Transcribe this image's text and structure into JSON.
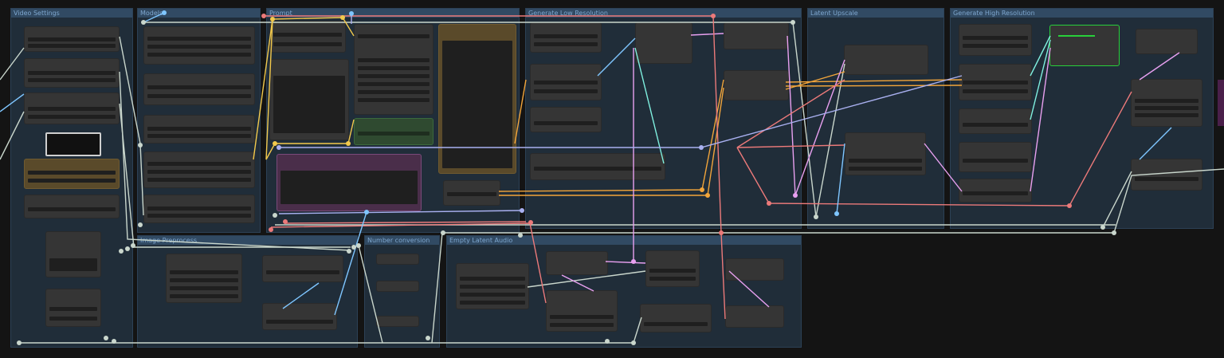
{
  "app": {
    "name": "node-graph-editor"
  },
  "groups": [
    {
      "id": "video_settings",
      "title": "Video Settings"
    },
    {
      "id": "models",
      "title": "Models"
    },
    {
      "id": "prompt",
      "title": "Prompt"
    },
    {
      "id": "low_res",
      "title": "Generate Low Resolution"
    },
    {
      "id": "latent_upscale",
      "title": "Latent Upscale"
    },
    {
      "id": "high_res",
      "title": "Generate High Resolution"
    },
    {
      "id": "image_preprocess",
      "title": "Image Preprocess"
    },
    {
      "id": "number_conversion",
      "title": "Number conversion"
    },
    {
      "id": "empty_latent_audio",
      "title": "Empty Latent Audio"
    }
  ],
  "colors": {
    "background": "#141414",
    "group_fill": "#31506e",
    "node_fill": "#353535",
    "selected_outline": "#28d03a",
    "wire_yellow": "#f2c94c",
    "wire_orange": "#f2a53b",
    "wire_pink": "#e8a0f0",
    "wire_red": "#ec7a7a",
    "wire_blue": "#7fc6ff",
    "wire_cyan": "#7ff0e0",
    "wire_gray": "#c9d6cc",
    "wire_lavender": "#a9b0f0"
  }
}
